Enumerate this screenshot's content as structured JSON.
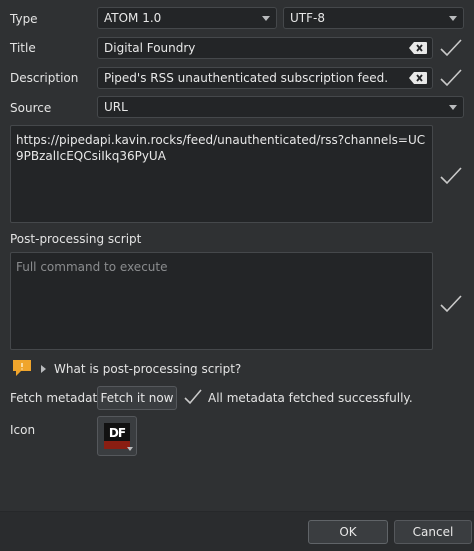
{
  "type": {
    "label": "Type",
    "format": "ATOM 1.0",
    "encoding": "UTF-8"
  },
  "title": {
    "label": "Title",
    "value": "Digital Foundry"
  },
  "description": {
    "label": "Description",
    "value": "Piped's RSS unauthenticated subscription feed."
  },
  "source": {
    "label": "Source",
    "kind": "URL",
    "value": "https://pipedapi.kavin.rocks/feed/unauthenticated/rss?channels=UC9PBzalIcEQCsiIkq36PyUA"
  },
  "post_processing": {
    "label": "Post-processing script",
    "placeholder": "Full command to execute",
    "help_text": "What is post-processing script?"
  },
  "fetch_metadata": {
    "label": "Fetch metadata",
    "button_label": "Fetch it now",
    "status": "All metadata fetched successfully."
  },
  "icon": {
    "label": "Icon",
    "glyph": "DF"
  },
  "footer": {
    "ok_label": "OK",
    "cancel_label": "Cancel"
  },
  "colors": {
    "check": "#c9c9c9",
    "hint": "#f0a52c",
    "icon_bg": "#8a1e12"
  }
}
